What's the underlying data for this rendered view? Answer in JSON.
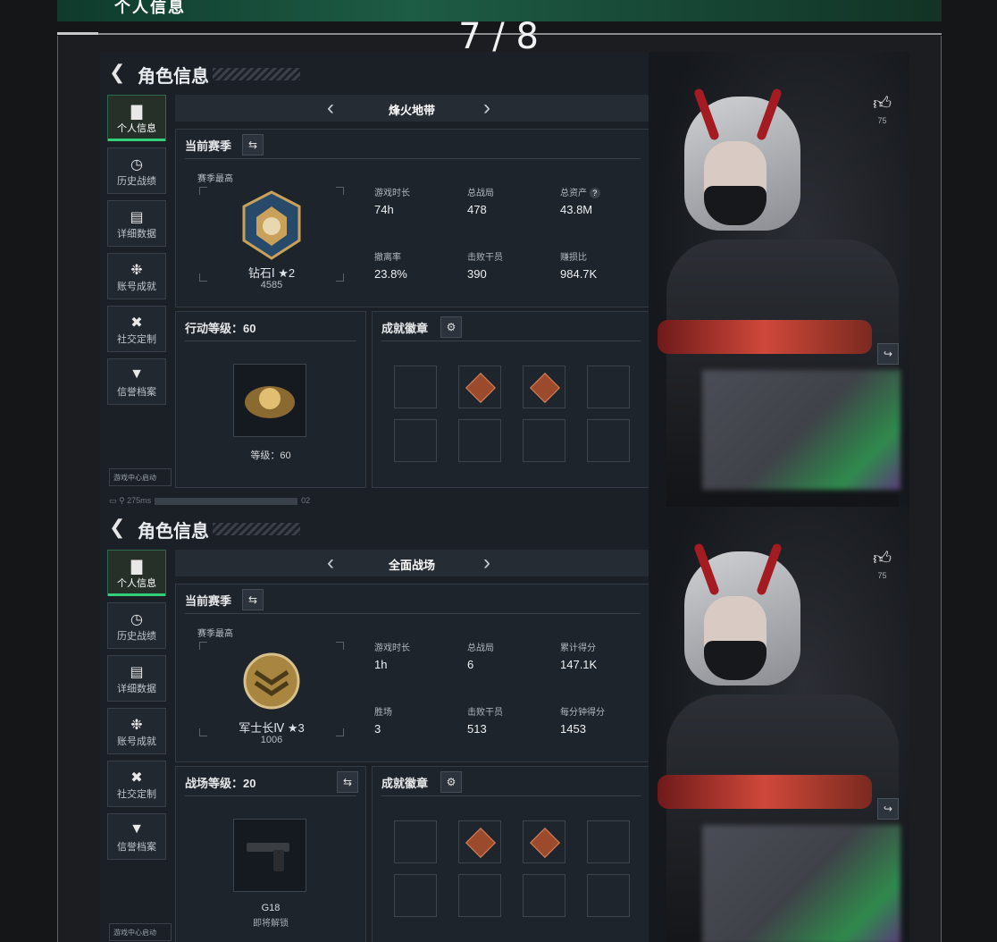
{
  "page": {
    "header_title": "个人信息",
    "counter": "7 / 8"
  },
  "screens": [
    {
      "title": "角色信息",
      "sidebar": [
        "个人信息",
        "历史战绩",
        "详细数据",
        "账号成就",
        "社交定制",
        "信誉档案"
      ],
      "game_center": "游戏中心启动",
      "mode": "烽火地带",
      "season_label": "当前赛季",
      "season_best": "赛季最高",
      "rank_name": "钻石Ⅰ ★2",
      "rank_points": "4585",
      "stats": [
        {
          "k": "游戏时长",
          "v": "74h"
        },
        {
          "k": "总战局",
          "v": "478"
        },
        {
          "k": "总资产",
          "v": "43.8M"
        },
        {
          "k": "撤离率",
          "v": "23.8%"
        },
        {
          "k": "击败干员",
          "v": "390"
        },
        {
          "k": "赚损比",
          "v": "984.7K"
        }
      ],
      "level_label": "行动等级：60",
      "level_caption": "等级：60",
      "level_caption2": "",
      "achievement_label": "成就徽章",
      "likes": "75",
      "status_ping": "275ms",
      "status_tail": "02"
    },
    {
      "title": "角色信息",
      "sidebar": [
        "个人信息",
        "历史战绩",
        "详细数据",
        "账号成就",
        "社交定制",
        "信誉档案"
      ],
      "game_center": "游戏中心启动",
      "mode": "全面战场",
      "season_label": "当前赛季",
      "season_best": "赛季最高",
      "rank_name": "军士长Ⅳ ★3",
      "rank_points": "1006",
      "stats": [
        {
          "k": "游戏时长",
          "v": "1h"
        },
        {
          "k": "总战局",
          "v": "6"
        },
        {
          "k": "累计得分",
          "v": "147.1K"
        },
        {
          "k": "胜场",
          "v": "3"
        },
        {
          "k": "击败干员",
          "v": "513"
        },
        {
          "k": "每分钟得分",
          "v": "1453"
        }
      ],
      "level_label": "战场等级：20",
      "level_caption": "G18",
      "level_caption2": "即将解锁",
      "achievement_label": "成就徽章",
      "likes": "75",
      "status_ping": "",
      "status_tail": ""
    }
  ],
  "icons": {
    "back": "back-arrow-icon",
    "sidebar": [
      "bar-chart-icon",
      "clock-icon",
      "folder-icon",
      "medal-icon",
      "tools-icon",
      "shield-icon"
    ],
    "like": "thumbs-up-icon",
    "share": "share-icon",
    "settings": "gear-icon",
    "swap": "swap-icon"
  },
  "colors": {
    "accent": "#32d07b",
    "background": "#1b2027",
    "header_green": "#1d5c45"
  }
}
